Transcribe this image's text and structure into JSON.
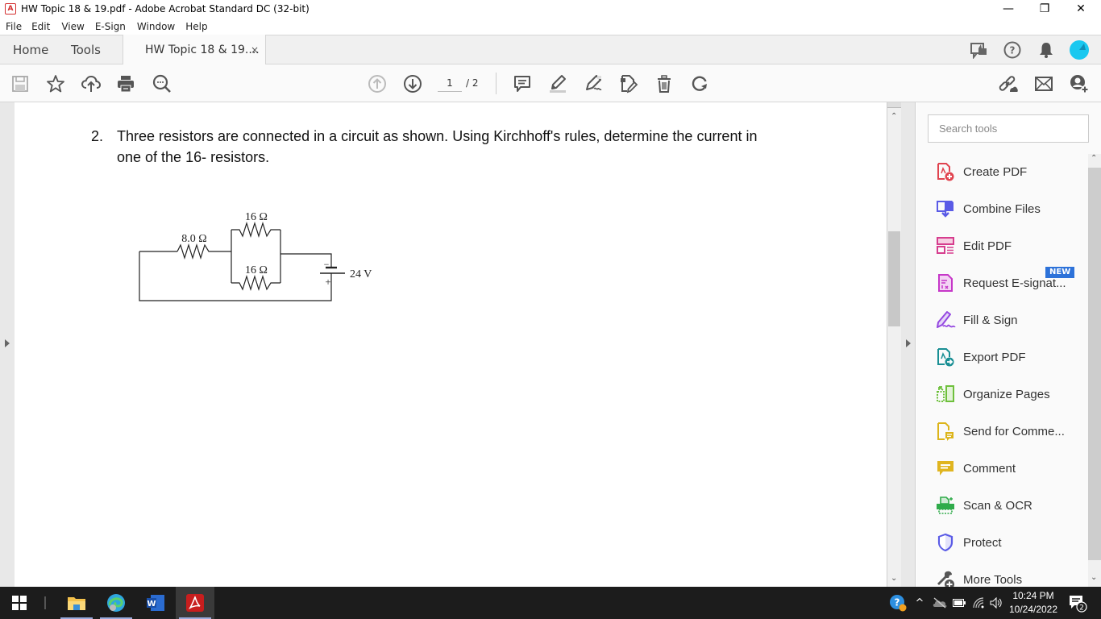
{
  "window": {
    "title": "HW Topic 18 & 19.pdf - Adobe Acrobat Standard DC (32-bit)",
    "minimize": "—",
    "restore": "❐",
    "close": "✕"
  },
  "menu": [
    "File",
    "Edit",
    "View",
    "E-Sign",
    "Window",
    "Help"
  ],
  "tabs": {
    "home": "Home",
    "tools": "Tools",
    "document": "HW Topic 18 & 19....",
    "close": "×"
  },
  "toolbar": {
    "current_page": "1",
    "total_pages": "/ 2"
  },
  "document": {
    "question_number": "2.",
    "question_line1": "Three resistors are connected in a circuit as shown. Using Kirchhoff's rules, determine the current in",
    "question_line2": "one of the 16- resistors.",
    "circuit": {
      "r1_label": "8.0 Ω",
      "r2_label": "16 Ω",
      "r3_label": "16 Ω",
      "battery_label": "24 V",
      "minus": "−",
      "plus": "+"
    }
  },
  "right_pane": {
    "search_placeholder": "Search tools",
    "new_badge": "NEW",
    "tools": [
      {
        "label": "Create PDF",
        "icon": "create-pdf-icon",
        "color": "#e0434f"
      },
      {
        "label": "Combine Files",
        "icon": "combine-files-icon",
        "color": "#5a5be6"
      },
      {
        "label": "Edit PDF",
        "icon": "edit-pdf-icon",
        "color": "#d63d8e"
      },
      {
        "label": "Request E-signat...",
        "icon": "request-esign-icon",
        "color": "#c637c8"
      },
      {
        "label": "Fill & Sign",
        "icon": "fill-sign-icon",
        "color": "#9447e0"
      },
      {
        "label": "Export PDF",
        "icon": "export-pdf-icon",
        "color": "#1a8f94"
      },
      {
        "label": "Organize Pages",
        "icon": "organize-pages-icon",
        "color": "#6ec03c"
      },
      {
        "label": "Send for Comme...",
        "icon": "send-comment-icon",
        "color": "#dcb41a"
      },
      {
        "label": "Comment",
        "icon": "comment-icon",
        "color": "#e0b520"
      },
      {
        "label": "Scan & OCR",
        "icon": "scan-ocr-icon",
        "color": "#2fab4a"
      },
      {
        "label": "Protect",
        "icon": "protect-icon",
        "color": "#5a5be6"
      },
      {
        "label": "More Tools",
        "icon": "more-tools-icon",
        "color": "#555555"
      }
    ]
  },
  "taskbar": {
    "time": "10:24 PM",
    "date": "10/24/2022",
    "notification_count": "2"
  }
}
